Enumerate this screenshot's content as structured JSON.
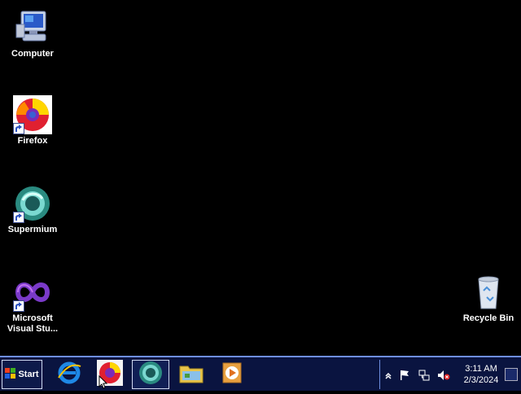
{
  "desktop": {
    "icons": [
      {
        "label": "Computer",
        "icon": "computer-icon"
      },
      {
        "label": "Firefox",
        "icon": "firefox-icon"
      },
      {
        "label": "Supermium",
        "icon": "supermium-icon"
      },
      {
        "label": "Microsoft\nVisual Stu...",
        "icon": "visual-studio-icon"
      },
      {
        "label": "Recycle Bin",
        "icon": "recycle-bin-icon"
      }
    ]
  },
  "taskbar": {
    "start_label": "Start",
    "pinned": [
      {
        "name": "internet-explorer",
        "icon": "internet-explorer-icon"
      },
      {
        "name": "firefox",
        "icon": "firefox-icon"
      },
      {
        "name": "supermium",
        "icon": "supermium-icon",
        "active": true
      },
      {
        "name": "file-explorer",
        "icon": "folder-icon"
      },
      {
        "name": "media-player",
        "icon": "media-player-icon"
      }
    ],
    "tray": {
      "icons": [
        "chevron-up-icon",
        "flag-icon",
        "network-icon",
        "volume-muted-icon"
      ],
      "time": "3:11 AM",
      "date": "2/3/2024"
    }
  },
  "colors": {
    "desktop_bg": "#000000",
    "taskbar_bg": "#0a1440",
    "taskbar_border": "#6e8ee0"
  }
}
